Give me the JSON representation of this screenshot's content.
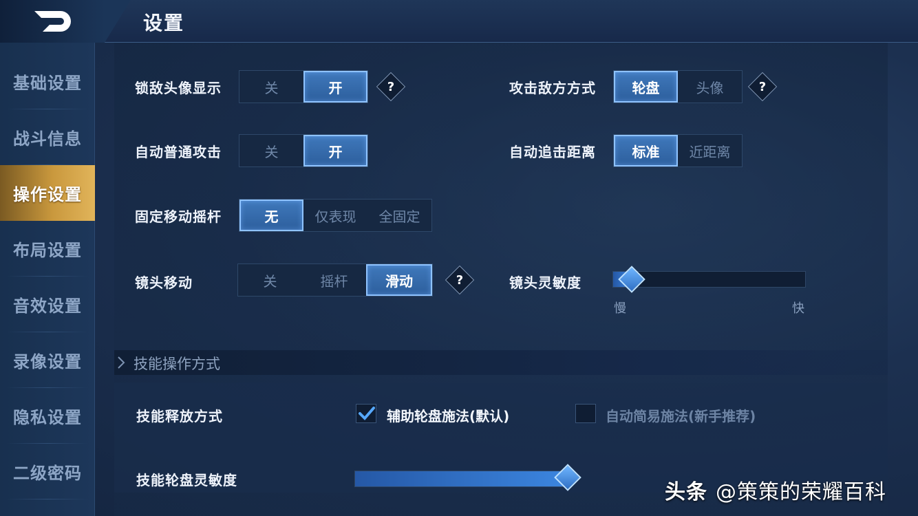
{
  "header": {
    "title": "设置",
    "back_icon": "back-arrow-icon"
  },
  "sidebar": {
    "items": [
      {
        "label": "基础设置",
        "active": false
      },
      {
        "label": "战斗信息",
        "active": false
      },
      {
        "label": "操作设置",
        "active": true
      },
      {
        "label": "布局设置",
        "active": false
      },
      {
        "label": "音效设置",
        "active": false
      },
      {
        "label": "录像设置",
        "active": false
      },
      {
        "label": "隐私设置",
        "active": false
      },
      {
        "label": "二级密码",
        "active": false
      }
    ]
  },
  "settings": {
    "lock_avatar": {
      "label": "锁敌头像显示",
      "options": [
        "关",
        "开"
      ],
      "selected": 1,
      "help": "?"
    },
    "attack_mode": {
      "label": "攻击敌方方式",
      "options": [
        "轮盘",
        "头像"
      ],
      "selected": 0,
      "help": "?"
    },
    "auto_attack": {
      "label": "自动普通攻击",
      "options": [
        "关",
        "开"
      ],
      "selected": 1
    },
    "chase_distance": {
      "label": "自动追击距离",
      "options": [
        "标准",
        "近距离"
      ],
      "selected": 0
    },
    "fixed_joystick": {
      "label": "固定移动摇杆",
      "options": [
        "无",
        "仅表现",
        "全固定"
      ],
      "selected": 0
    },
    "camera_move": {
      "label": "镜头移动",
      "options": [
        "关",
        "摇杆",
        "滑动"
      ],
      "selected": 2,
      "help": "?"
    },
    "camera_sensitivity": {
      "label": "镜头灵敏度",
      "min_label": "慢",
      "max_label": "快",
      "value": 0.1
    }
  },
  "skill_section": {
    "title": "技能操作方式",
    "release_mode": {
      "label": "技能释放方式",
      "options": [
        {
          "label": "辅助轮盘施法(默认)",
          "checked": true
        },
        {
          "label": "自动简易施法(新手推荐)",
          "checked": false
        }
      ]
    },
    "wheel_sensitivity": {
      "label": "技能轮盘灵敏度",
      "value": 1.0
    }
  },
  "watermark": {
    "brand": "头条",
    "text": "@策策的荣耀百科"
  },
  "colors": {
    "accent": "#3f78bb",
    "active_tab": "#c9983d",
    "background": "#1c3050"
  }
}
